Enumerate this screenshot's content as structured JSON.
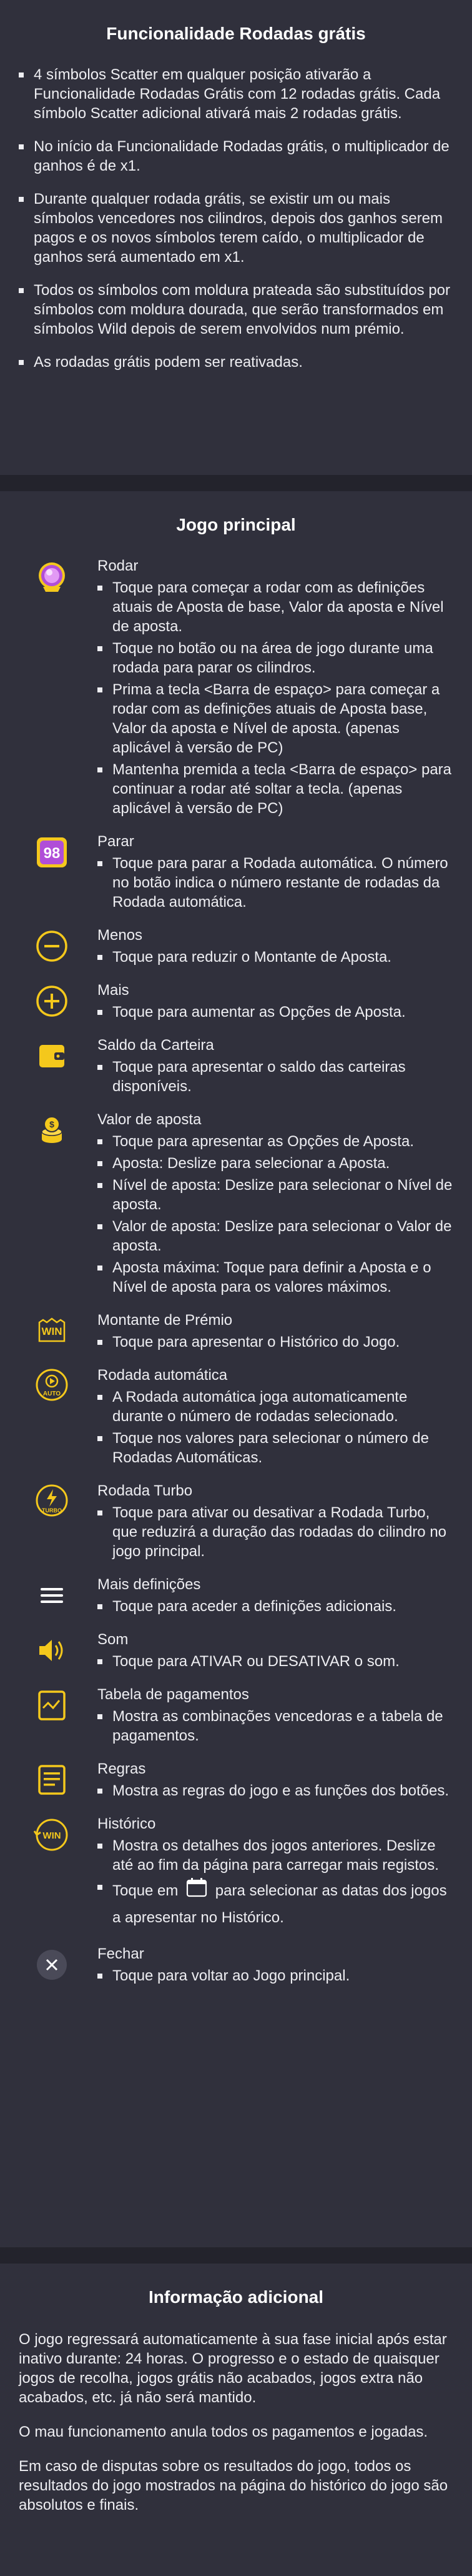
{
  "free_spins": {
    "title": "Funcionalidade Rodadas grátis",
    "bullets": [
      "4 símbolos Scatter em qualquer posição ativarão a Funcionalidade Rodadas Grátis com 12 rodadas grátis. Cada símbolo Scatter adicional ativará mais 2 rodadas grátis.",
      "No início da Funcionalidade Rodadas grátis, o multiplicador de ganhos é de x1.",
      "Durante qualquer rodada grátis, se existir um ou mais símbolos vencedores nos cilindros, depois dos ganhos serem pagos e os novos símbolos terem caído, o multiplicador de ganhos será aumentado em x1.",
      "Todos os símbolos com moldura prateada são substituídos por símbolos com moldura dourada, que serão transformados em símbolos Wild depois de serem envolvidos num prémio.",
      "As rodadas grátis podem ser reativadas."
    ]
  },
  "main_game": {
    "title": "Jogo principal",
    "features": [
      {
        "name": "Rodar",
        "icon": "spin-icon",
        "items": [
          "Toque para começar a rodar com as definições atuais de Aposta de base, Valor da aposta e Nível de aposta.",
          "Toque no botão ou na área de jogo durante uma rodada para parar os cilindros.",
          "Prima a tecla <Barra de espaço> para começar a rodar com as definições atuais de Aposta base, Valor da aposta e Nível de aposta. (apenas aplicável à versão de PC)",
          "Mantenha premida a tecla <Barra de espaço> para continuar a rodar até soltar a tecla. (apenas aplicável à versão de PC)"
        ]
      },
      {
        "name": "Parar",
        "icon": "stop-autospin-icon",
        "badge": "98",
        "items": [
          "Toque para parar a Rodada automática. O número no botão indica o número restante de rodadas da Rodada automática."
        ]
      },
      {
        "name": "Menos",
        "icon": "minus-icon",
        "items": [
          "Toque para reduzir o Montante de Aposta."
        ]
      },
      {
        "name": "Mais",
        "icon": "plus-icon",
        "items": [
          "Toque para aumentar as Opções de Aposta."
        ]
      },
      {
        "name": "Saldo da Carteira",
        "icon": "wallet-icon",
        "items": [
          "Toque para apresentar o saldo das carteiras disponíveis."
        ]
      },
      {
        "name": "Valor de aposta",
        "icon": "coins-icon",
        "items": [
          "Toque para apresentar as Opções de Aposta.",
          "Aposta: Deslize para selecionar a Aposta.",
          "Nível de aposta: Deslize para selecionar o Nível de aposta.",
          "Valor de aposta: Deslize para selecionar o Valor de aposta.",
          "Aposta máxima: Toque para definir a Aposta e o Nível de aposta para os valores máximos."
        ]
      },
      {
        "name": "Montante de Prémio",
        "icon": "win-icon",
        "badge": "WIN",
        "items": [
          "Toque para apresentar o Histórico do Jogo."
        ]
      },
      {
        "name": "Rodada automática",
        "icon": "auto-icon",
        "badge": "AUTO",
        "items": [
          "A Rodada automática joga automaticamente durante o número de rodadas selecionado.",
          "Toque nos valores para selecionar o número de Rodadas Automáticas."
        ]
      },
      {
        "name": "Rodada Turbo",
        "icon": "turbo-icon",
        "badge": "TURBO",
        "items": [
          "Toque para ativar ou desativar a Rodada Turbo, que reduzirá a duração das rodadas do cilindro no jogo principal."
        ]
      },
      {
        "name": "Mais definições",
        "icon": "menu-icon",
        "items": [
          "Toque para aceder a definições adicionais."
        ]
      },
      {
        "name": "Som",
        "icon": "sound-icon",
        "items": [
          "Toque para ATIVAR ou DESATIVAR o som."
        ]
      },
      {
        "name": "Tabela de pagamentos",
        "icon": "paytable-icon",
        "items": [
          "Mostra as combinações vencedoras e a tabela de pagamentos."
        ]
      },
      {
        "name": "Regras",
        "icon": "rules-icon",
        "items": [
          "Mostra as regras do jogo e as funções dos botões."
        ]
      },
      {
        "name": "Histórico",
        "icon": "history-icon",
        "badge": "WIN",
        "items": [
          "Mostra os detalhes dos jogos anteriores. Deslize até ao fim da página para carregar mais registos."
        ],
        "calendar_before": "Toque em",
        "calendar_after": "para selecionar as datas dos jogos a apresentar no Histórico."
      },
      {
        "name": "Fechar",
        "icon": "close-icon",
        "items": [
          "Toque para voltar ao Jogo principal."
        ]
      }
    ]
  },
  "additional": {
    "title": "Informação adicional",
    "paragraphs": [
      "O jogo regressará automaticamente à sua fase inicial após estar inativo durante: 24 horas. O progresso e o estado de quaisquer jogos de recolha, jogos grátis não acabados, jogos extra não acabados, etc. já não será mantido.",
      "O mau funcionamento anula todos os pagamentos e jogadas.",
      "Em caso de disputas sobre os resultados do jogo, todos os resultados do jogo mostrados na página do histórico do jogo são absolutos e finais."
    ]
  },
  "colors": {
    "bg": "#30303c",
    "divider": "#23232c",
    "icon_gold": "#f4c81c",
    "text": "#eeeef2"
  }
}
